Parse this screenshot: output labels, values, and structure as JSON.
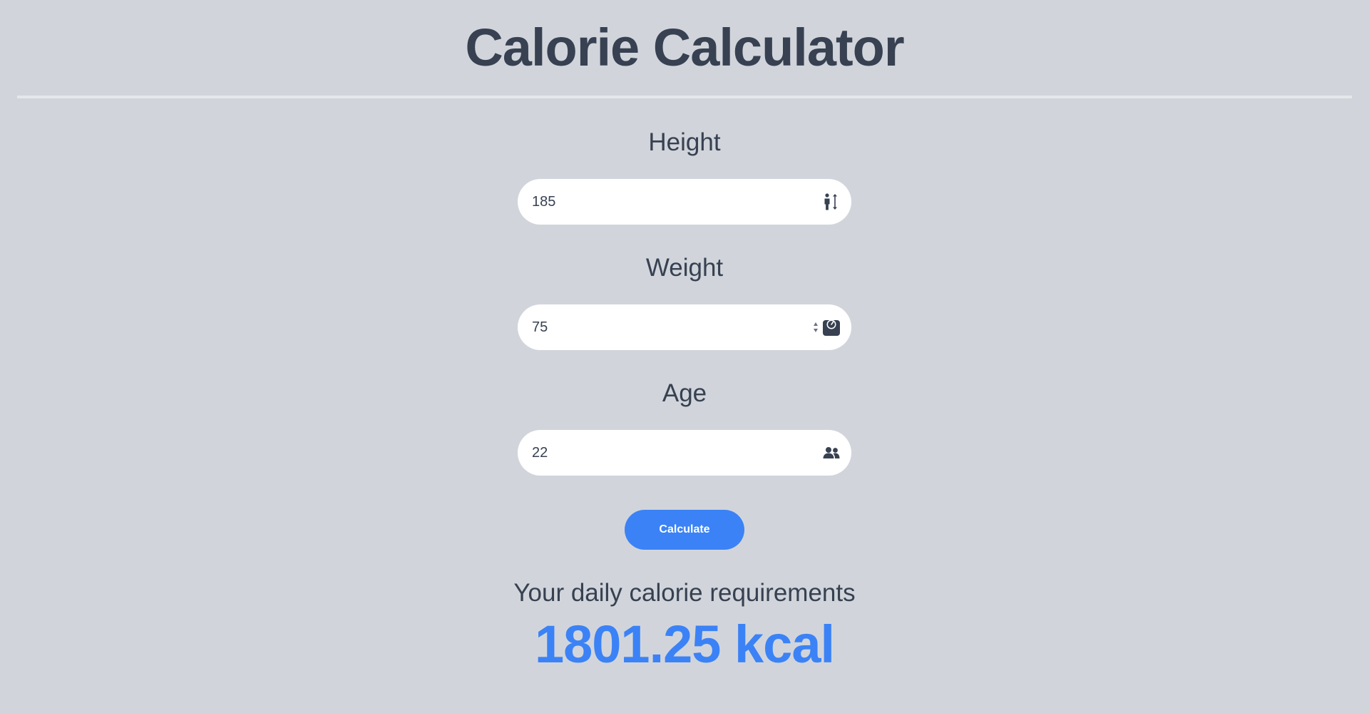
{
  "header": {
    "title": "Calorie Calculator"
  },
  "fields": [
    {
      "label": "Height",
      "value": "185",
      "icon": "person-height-icon"
    },
    {
      "label": "Weight",
      "value": "75",
      "icon": "weight-scale-icon"
    },
    {
      "label": "Age",
      "value": "22",
      "icon": "users-icon"
    }
  ],
  "actions": {
    "calculate_label": "Calculate"
  },
  "result": {
    "label": "Your daily calorie requirements",
    "value": "1801.25 kcal"
  },
  "colors": {
    "background": "#d1d5db",
    "text": "#374151",
    "accent": "#3b82f6",
    "input_bg": "#ffffff"
  }
}
